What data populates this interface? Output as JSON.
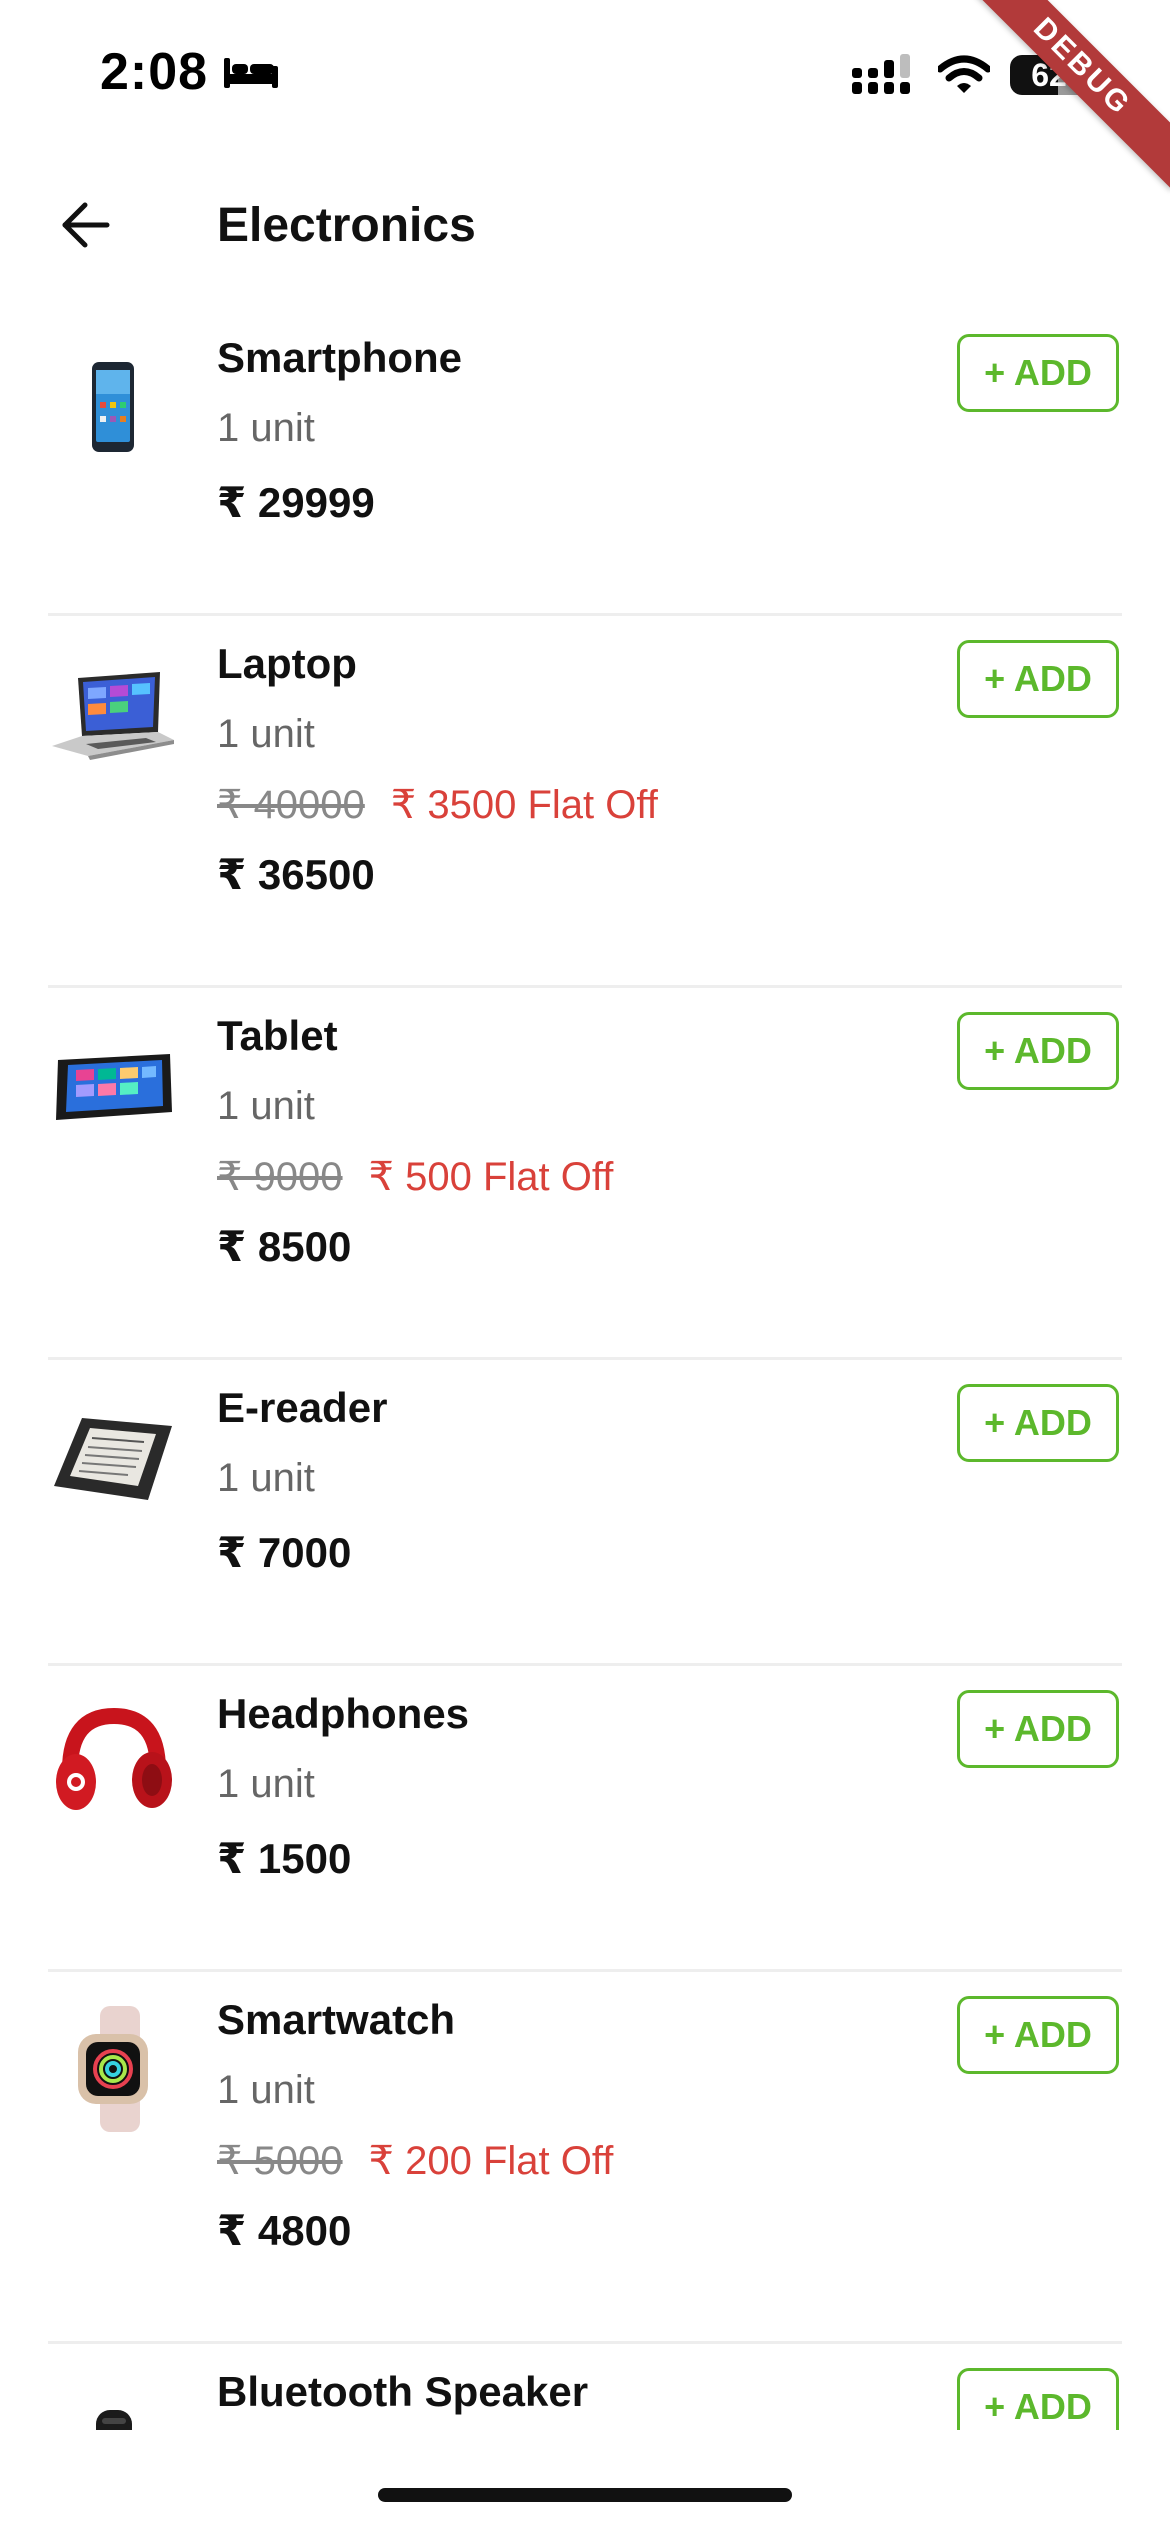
{
  "status_bar": {
    "time": "2:08",
    "battery_level": "62",
    "debug_label": "DEBUG"
  },
  "app_bar": {
    "title": "Electronics",
    "back_icon": "arrow-left-icon"
  },
  "colors": {
    "accent_green": "#5cb82c",
    "discount_red": "#d9413a"
  },
  "products": [
    {
      "name": "Smartphone",
      "unit": "1 unit",
      "final_price": "₹ 29999",
      "add_label": "+ ADD",
      "image_icon": "smartphone-icon"
    },
    {
      "name": "Laptop",
      "unit": "1 unit",
      "original_price": "₹ 40000",
      "discount": "₹ 3500 Flat Off",
      "final_price": "₹ 36500",
      "add_label": "+ ADD",
      "image_icon": "laptop-icon"
    },
    {
      "name": "Tablet",
      "unit": "1 unit",
      "original_price": "₹ 9000",
      "discount": "₹ 500 Flat Off",
      "final_price": "₹ 8500",
      "add_label": "+ ADD",
      "image_icon": "tablet-icon"
    },
    {
      "name": "E-reader",
      "unit": "1 unit",
      "final_price": "₹ 7000",
      "add_label": "+ ADD",
      "image_icon": "ereader-icon"
    },
    {
      "name": "Headphones",
      "unit": "1 unit",
      "final_price": "₹ 1500",
      "add_label": "+ ADD",
      "image_icon": "headphones-icon"
    },
    {
      "name": "Smartwatch",
      "unit": "1 unit",
      "original_price": "₹ 5000",
      "discount": "₹ 200 Flat Off",
      "final_price": "₹ 4800",
      "add_label": "+ ADD",
      "image_icon": "smartwatch-icon"
    },
    {
      "name": "Bluetooth Speaker",
      "add_label": "+ ADD",
      "image_icon": "speaker-icon"
    }
  ]
}
